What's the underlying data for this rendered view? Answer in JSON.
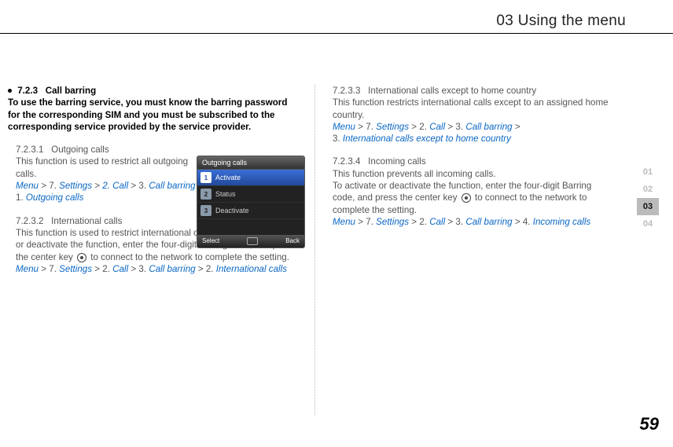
{
  "header": {
    "title": "03 Using the menu"
  },
  "side": {
    "t1": "01",
    "t2": "02",
    "t3": "03",
    "t4": "04"
  },
  "page": {
    "num": "59"
  },
  "left": {
    "h1_num": "7.2.3",
    "h1_title": "Call barring",
    "intro": "To use the barring service, you must know the barring password for the corresponding SIM and you must be subscribed to the corresponding service provided by the service provider.",
    "s1_num": "7.2.3.1",
    "s1_title": "Outgoing calls",
    "s1_body": "This function is used to restrict all outgoing calls.",
    "s1_path_a": "Menu",
    "s1_path_b": "7.",
    "s1_path_c": "Settings",
    "s1_path_d": "2. Call",
    "s1_path_e": "3.",
    "s1_path_f": "Call barring",
    "s1_path_g": "1.",
    "s1_path_h": "Outgoing calls",
    "s2_num": "7.2.3.2",
    "s2_title": "International calls",
    "s2_body1": "This function is used to restrict international outgoing calls. To activate or deactivate the function, enter the four-digit barring code, and press the center key",
    "s2_body2": "to connect to the network to complete the setting.",
    "s2_path_a": "Menu",
    "s2_path_b": "7.",
    "s2_path_c": "Settings",
    "s2_path_d": "2.",
    "s2_path_e": "Call",
    "s2_path_f": "3.",
    "s2_path_g": "Call barring",
    "s2_path_h": "2.",
    "s2_path_i": "International calls"
  },
  "right": {
    "s3_num": "7.2.3.3",
    "s3_title": "International calls except to home country",
    "s3_body": "This function restricts international calls except to an assigned home country.",
    "s3_path_a": "Menu",
    "s3_path_b": "7.",
    "s3_path_c": "Settings",
    "s3_path_d": "2.",
    "s3_path_e": "Call",
    "s3_path_f": "3.",
    "s3_path_g": "Call barring",
    "s3_path_h": "3.",
    "s3_path_i": "International calls except to home country",
    "s4_num": "7.2.3.4",
    "s4_title": "Incoming calls",
    "s4_body1": "This function prevents all incoming calls.",
    "s4_body2a": "To activate or deactivate the function, enter the four-digit Barring code, and press the center key",
    "s4_body2b": "to connect to the network to complete the setting.",
    "s4_path_a": "Menu",
    "s4_path_b": "7.",
    "s4_path_c": "Settings",
    "s4_path_d": "2.",
    "s4_path_e": "Call",
    "s4_path_f": "3.",
    "s4_path_g": "Call barring",
    "s4_path_h": "4.",
    "s4_path_i": "Incoming calls"
  },
  "phone": {
    "title": "Outgoing calls",
    "r1n": "1",
    "r1": "Activate",
    "r2n": "2",
    "r2": "Status",
    "r3n": "3",
    "r3": "Deactivate",
    "fL": "Select",
    "fR": "Back"
  }
}
